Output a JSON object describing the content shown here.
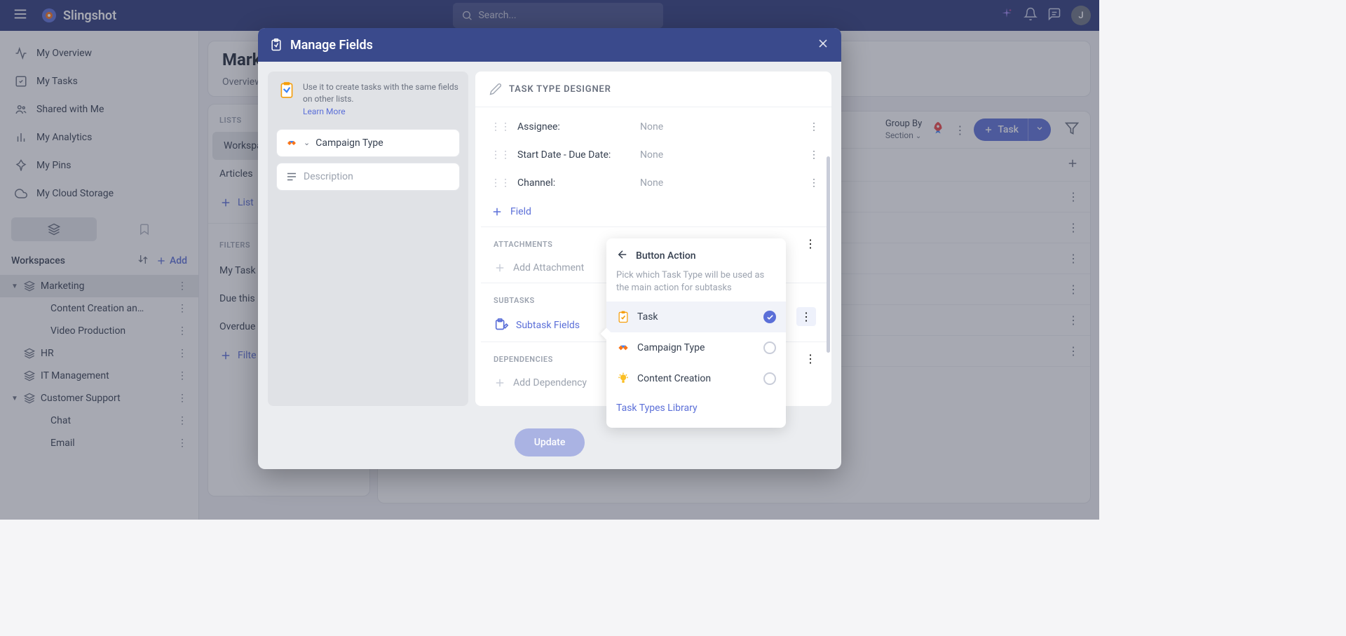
{
  "topbar": {
    "brand": "Slingshot",
    "search_placeholder": "Search...",
    "avatar_initial": "J"
  },
  "sidebar": {
    "nav": [
      {
        "label": "My Overview"
      },
      {
        "label": "My Tasks"
      },
      {
        "label": "Shared with Me"
      },
      {
        "label": "My Analytics"
      },
      {
        "label": "My Pins"
      },
      {
        "label": "My Cloud Storage"
      }
    ],
    "workspaces_label": "Workspaces",
    "add_label": "Add",
    "workspaces": [
      {
        "name": "Marketing",
        "expanded": true,
        "children": [
          {
            "name": "Content Creation an…"
          },
          {
            "name": "Video Production"
          }
        ]
      },
      {
        "name": "HR"
      },
      {
        "name": "IT Management"
      },
      {
        "name": "Customer Support",
        "expanded": true,
        "children": [
          {
            "name": "Chat"
          },
          {
            "name": "Email"
          }
        ]
      }
    ]
  },
  "content": {
    "title": "Marke",
    "subtab": "Overview",
    "side_panel": {
      "lists_heading": "LISTS",
      "lists": [
        {
          "label": "Workspa",
          "active": true
        },
        {
          "label": "Articles"
        }
      ],
      "list_add": "List",
      "filters_heading": "FILTERS",
      "filters": [
        {
          "label": "My Task"
        },
        {
          "label": "Due this"
        },
        {
          "label": "Overdue"
        }
      ],
      "filter_add": "Filte"
    },
    "toolbar": {
      "groupby_label": "Group By",
      "groupby_value": "Section",
      "task_button": "Task"
    }
  },
  "modal": {
    "title": "Manage Fields",
    "left": {
      "info": "Use it to create tasks with the same fields on other lists.",
      "learn_more": "Learn More",
      "campaign_type": "Campaign Type",
      "description_placeholder": "Description"
    },
    "right": {
      "designer_title": "TASK TYPE DESIGNER",
      "fields": [
        {
          "label": "Assignee:",
          "value": "None"
        },
        {
          "label": "Start Date - Due Date:",
          "value": "None"
        },
        {
          "label": "Channel:",
          "value": "None"
        }
      ],
      "add_field": "Field",
      "attachments_heading": "ATTACHMENTS",
      "add_attachment": "Add Attachment",
      "subtasks_heading": "SUBTASKS",
      "subtask_fields": "Subtask Fields",
      "dependencies_heading": "DEPENDENCIES",
      "add_dependency": "Add Dependency"
    },
    "update": "Update"
  },
  "popover": {
    "title": "Button Action",
    "desc": "Pick which Task Type will be used as the main action for subtasks",
    "items": [
      {
        "label": "Task",
        "selected": true
      },
      {
        "label": "Campaign Type",
        "selected": false
      },
      {
        "label": "Content Creation",
        "selected": false
      }
    ],
    "library_link": "Task Types Library"
  }
}
